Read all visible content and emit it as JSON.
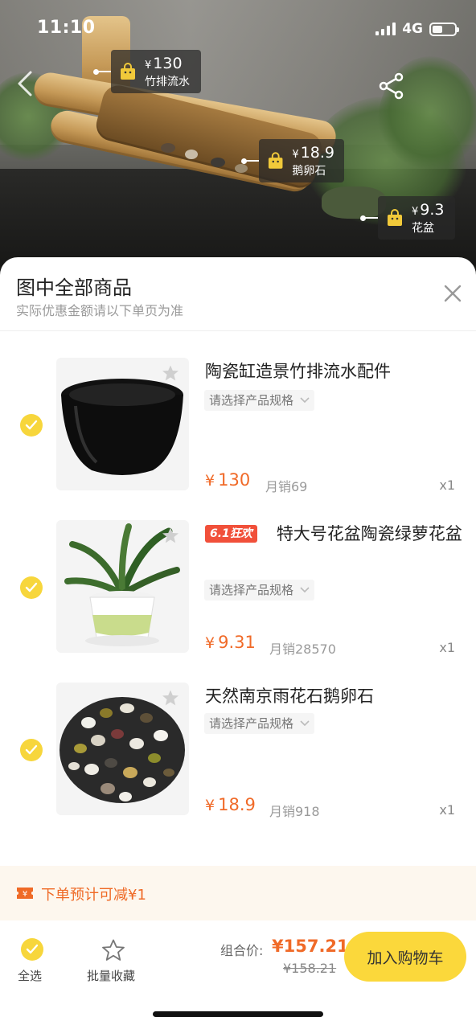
{
  "status_bar": {
    "time": "11:10",
    "network": "4G"
  },
  "photo_tags": [
    {
      "price": "130",
      "currency": "¥",
      "name": "竹排流水"
    },
    {
      "price": "18.9",
      "currency": "¥",
      "name": "鹅卵石"
    },
    {
      "price": "9.3",
      "currency": "¥",
      "name": "花盆"
    }
  ],
  "sheet": {
    "title": "图中全部商品",
    "subtitle": "实际优惠金额请以下单页为准"
  },
  "products": [
    {
      "title": "陶瓷缸造景竹排流水配件",
      "badge": "",
      "spec_placeholder": "请选择产品规格",
      "currency": "¥",
      "price": "130",
      "sales": "月销69",
      "quantity": "x1",
      "checked": true
    },
    {
      "title": "特大号花盆陶瓷绿萝花盆",
      "badge": "6.1狂欢",
      "spec_placeholder": "请选择产品规格",
      "currency": "¥",
      "price": "9.31",
      "sales": "月销28570",
      "quantity": "x1",
      "checked": true
    },
    {
      "title": "天然南京雨花石鹅卵石",
      "badge": "",
      "spec_placeholder": "请选择产品规格",
      "currency": "¥",
      "price": "18.9",
      "sales": "月销918",
      "quantity": "x1",
      "checked": true
    }
  ],
  "discount": {
    "text": "下单预计可减¥1"
  },
  "bottom_bar": {
    "select_all_label": "全选",
    "bulk_favorite_label": "批量收藏",
    "combo_label": "组合价:",
    "combo_price": "¥157.21",
    "original_price": "¥158.21",
    "add_to_cart_label": "加入购物车"
  },
  "colors": {
    "accent_yellow": "#f7d63c",
    "price_orange": "#f06a28",
    "badge_red": "#f1503a"
  }
}
